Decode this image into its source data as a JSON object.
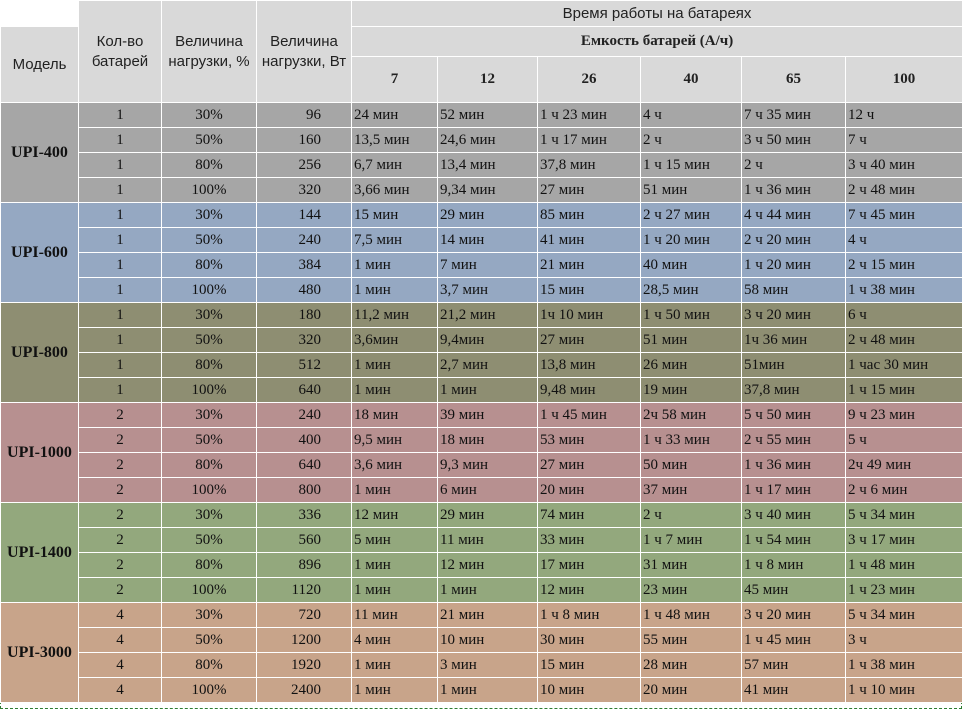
{
  "header": {
    "model": "Модель",
    "count": "Кол-во батарей",
    "load_pct": "Величина нагрузки, %",
    "load_w": "Величина нагрузки, Вт",
    "runtime_title": "Время работы на батареях",
    "capacity_title": "Емкость батарей (А/ч)",
    "capacities": [
      "7",
      "12",
      "26",
      "40",
      "65",
      "100"
    ]
  },
  "groups": [
    {
      "model": "UPI-400",
      "rows": [
        {
          "count": "1",
          "pct": "30%",
          "watts": "96",
          "times": [
            "24 мин",
            "52 мин",
            "1 ч 23 мин",
            "4 ч",
            "7 ч 35 мин",
            "12 ч"
          ]
        },
        {
          "count": "1",
          "pct": "50%",
          "watts": "160",
          "times": [
            "13,5 мин",
            "24,6 мин",
            "1 ч 17 мин",
            "2 ч",
            "3 ч 50 мин",
            "7 ч"
          ]
        },
        {
          "count": "1",
          "pct": "80%",
          "watts": "256",
          "times": [
            "6,7 мин",
            "13,4  мин",
            "37,8 мин",
            "1 ч 15 мин",
            "2 ч",
            "3 ч 40 мин"
          ]
        },
        {
          "count": "1",
          "pct": "100%",
          "watts": "320",
          "times": [
            "3,66 мин",
            "9,34 мин",
            "27 мин",
            "51 мин",
            "1 ч 36 мин",
            "2 ч 48 мин"
          ]
        }
      ]
    },
    {
      "model": "UPI-600",
      "rows": [
        {
          "count": "1",
          "pct": "30%",
          "watts": "144",
          "times": [
            "15 мин",
            "29 мин",
            "85 мин",
            "2 ч 27 мин",
            "4 ч 44 мин",
            "7 ч 45 мин"
          ]
        },
        {
          "count": "1",
          "pct": "50%",
          "watts": "240",
          "times": [
            "7,5 мин",
            "14 мин",
            "41 мин",
            "1 ч 20 мин",
            "2 ч 20 мин",
            "4 ч"
          ]
        },
        {
          "count": "1",
          "pct": "80%",
          "watts": "384",
          "times": [
            "1 мин",
            "7 мин",
            "21 мин",
            "40 мин",
            "1 ч 20 мин",
            "2 ч 15 мин"
          ]
        },
        {
          "count": "1",
          "pct": "100%",
          "watts": "480",
          "times": [
            "1 мин",
            "3,7 мин",
            "15 мин",
            "28,5 мин",
            "58 мин",
            "1 ч 38 мин"
          ]
        }
      ]
    },
    {
      "model": "UPI-800",
      "rows": [
        {
          "count": "1",
          "pct": "30%",
          "watts": "180",
          "times": [
            "11,2 мин",
            "21,2 мин",
            "1ч 10 мин",
            "1 ч 50 мин",
            "3 ч 20 мин",
            "6 ч"
          ]
        },
        {
          "count": "1",
          "pct": "50%",
          "watts": "320",
          "times": [
            "3,6мин",
            "9,4мин",
            "27 мин",
            "51 мин",
            "1ч 36 мин",
            "2 ч 48 мин"
          ]
        },
        {
          "count": "1",
          "pct": "80%",
          "watts": "512",
          "times": [
            "1 мин",
            "2,7 мин",
            "13,8 мин",
            "26 мин",
            "51мин",
            "1 час 30 мин"
          ]
        },
        {
          "count": "1",
          "pct": "100%",
          "watts": "640",
          "times": [
            "1 мин",
            "1 мин",
            "9,48 мин",
            "19 мин",
            "37,8 мин",
            "1 ч 15 мин"
          ]
        }
      ]
    },
    {
      "model": "UPI-1000",
      "rows": [
        {
          "count": "2",
          "pct": "30%",
          "watts": "240",
          "times": [
            "18 мин",
            "39 мин",
            "1 ч 45  мин",
            "2ч 58 мин",
            "5 ч 50  мин",
            "9 ч 23 мин"
          ]
        },
        {
          "count": "2",
          "pct": "50%",
          "watts": "400",
          "times": [
            "9,5 мин",
            "18 мин",
            "53 мин",
            "1 ч 33 мин",
            "2 ч 55 мин",
            "5 ч"
          ]
        },
        {
          "count": "2",
          "pct": "80%",
          "watts": "640",
          "times": [
            "3,6 мин",
            "9,3 мин",
            "27 мин",
            "50 мин",
            "1 ч 36 мин",
            "2ч 49 мин"
          ]
        },
        {
          "count": "2",
          "pct": "100%",
          "watts": "800",
          "times": [
            "1 мин",
            "6 мин",
            "20 мин",
            "37 мин",
            "1 ч 17  мин",
            "2 ч 6  мин"
          ]
        }
      ]
    },
    {
      "model": "UPI-1400",
      "rows": [
        {
          "count": "2",
          "pct": "30%",
          "watts": "336",
          "times": [
            "12 мин",
            "29 мин",
            "74 мин",
            "2 ч",
            "3 ч 40 мин",
            "5 ч 34 мин"
          ]
        },
        {
          "count": "2",
          "pct": "50%",
          "watts": "560",
          "times": [
            "5 мин",
            "11 мин",
            "33 мин",
            "1 ч 7 мин",
            "1 ч 54 мин",
            "3 ч 17 мин"
          ]
        },
        {
          "count": "2",
          "pct": "80%",
          "watts": "896",
          "times": [
            "1 мин",
            "12 мин",
            "17 мин",
            "31 мин",
            "1 ч 8 мин",
            "1 ч 48 мин"
          ]
        },
        {
          "count": "2",
          "pct": "100%",
          "watts": "1120",
          "times": [
            "1 мин",
            "1 мин",
            "12 мин",
            "23 мин",
            "45 мин",
            "1 ч 23 мин"
          ]
        }
      ]
    },
    {
      "model": "UPI-3000",
      "rows": [
        {
          "count": "4",
          "pct": "30%",
          "watts": "720",
          "times": [
            "11 мин",
            "21 мин",
            "1 ч 8 мин",
            "1 ч 48 мин",
            "3 ч 20 мин",
            "5 ч 34 мин"
          ]
        },
        {
          "count": "4",
          "pct": "50%",
          "watts": "1200",
          "times": [
            "4 мин",
            "10 мин",
            "30 мин",
            "55 мин",
            "1 ч 45 мин",
            "3 ч"
          ]
        },
        {
          "count": "4",
          "pct": "80%",
          "watts": "1920",
          "times": [
            "1 мин",
            "3 мин",
            "15 мин",
            "28 мин",
            "57 мин",
            "1 ч 38 мин"
          ]
        },
        {
          "count": "4",
          "pct": "100%",
          "watts": "2400",
          "times": [
            "1 мин",
            "1 мин",
            "10 мин",
            "20 мин",
            "41 мин",
            "1 ч 10 мин"
          ]
        }
      ]
    }
  ]
}
